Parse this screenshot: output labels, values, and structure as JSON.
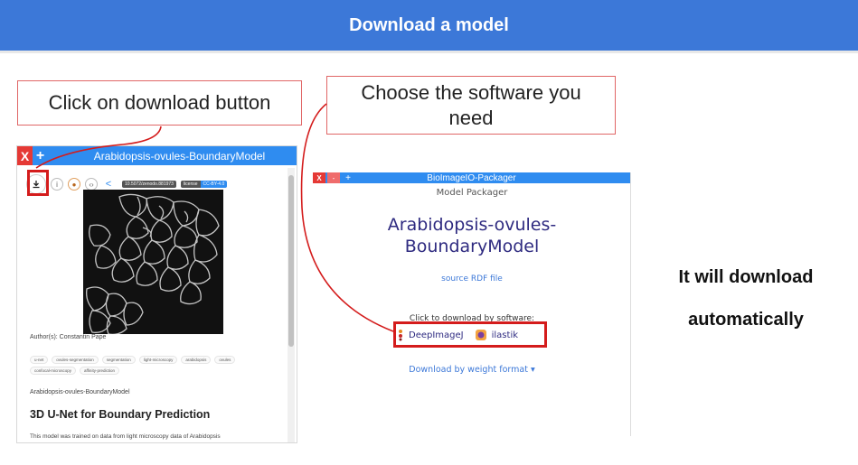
{
  "banner": {
    "title": "Download a model"
  },
  "callouts": {
    "step1": "Click on download button",
    "step2": "Choose the software you need",
    "final_line1": "It will download",
    "final_line2": "automatically"
  },
  "left_panel": {
    "title": "Arabidopsis-ovules-BoundaryModel",
    "close": "X",
    "add": "+",
    "doi": "10.5072/zenodo.881973",
    "license_label": "license",
    "license_value": "CC-BY-4.0",
    "authors": "Author(s): Constantin Pape",
    "tags": [
      "u-net",
      "ovules-segmentation",
      "segmentation",
      "light-microscopy",
      "arabidopsis",
      "ovules",
      "confocal-microscopy",
      "affinity-prediction"
    ],
    "model_name": "Arabidopsis-ovules-BoundaryModel",
    "heading": "3D U-Net for Boundary Prediction",
    "description": "This model was trained on data from light microscopy data of Arabidopsis"
  },
  "right_panel": {
    "title": "BioImageIO-Packager",
    "close": "X",
    "minimize": "-",
    "add": "+",
    "subtitle": "Model Packager",
    "model_line1": "Arabidopsis-ovules-",
    "model_line2": "BoundaryModel",
    "source_link": "source RDF file",
    "click_prompt": "Click to download by software:",
    "software": [
      "DeepImageJ",
      "ilastik"
    ],
    "weight_format": "Download by weight format ▾"
  },
  "colors": {
    "banner": "#3c78d8",
    "highlight": "#d41c1c",
    "titlebar": "#2f8cf0",
    "model_name": "#2e2a80"
  }
}
